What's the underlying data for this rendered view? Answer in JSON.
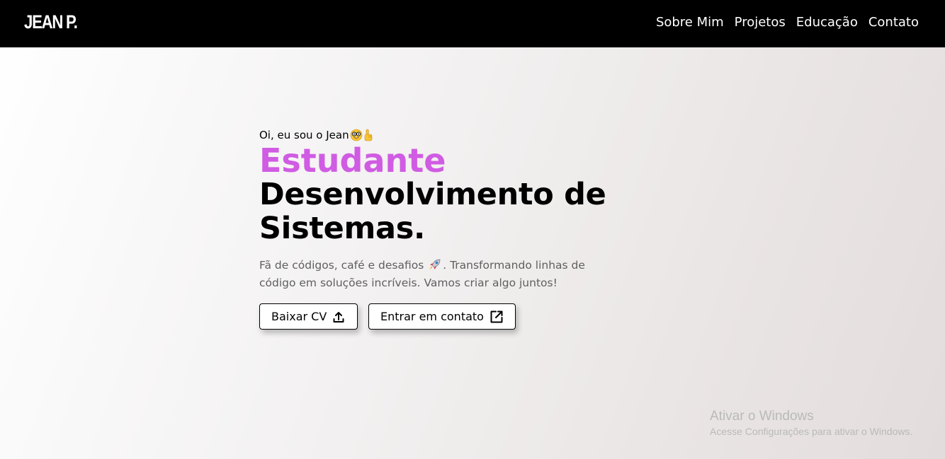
{
  "nav": {
    "logo": "JEAN P.",
    "links": [
      "Sobre Mim",
      "Projetos",
      "Educação",
      "Contato"
    ]
  },
  "hero": {
    "greeting": "Oi, eu sou o Jean",
    "greeting_emojis": [
      "nerd-face-icon",
      "pointing-up-icon"
    ],
    "title_accent": "Estudante",
    "title_main": "Desenvolvimento de Sistemas.",
    "description_part1": "Fã de códigos, café e desafios",
    "description_part2": ". Transformando linhas de código em soluções incríveis. Vamos criar algo juntos!",
    "description_emoji": "rocket-icon"
  },
  "buttons": {
    "download_cv": "Baixar CV",
    "download_icon": "upload-icon",
    "contact": "Entrar em contato",
    "contact_icon": "external-link-icon"
  },
  "watermark": {
    "title": "Ativar o Windows",
    "subtitle": "Acesse Configurações para ativar o Windows."
  },
  "colors": {
    "navbar_bg": "#000000",
    "accent": "#d05ce3",
    "text": "#000000",
    "muted_text": "#5f5f5f"
  }
}
